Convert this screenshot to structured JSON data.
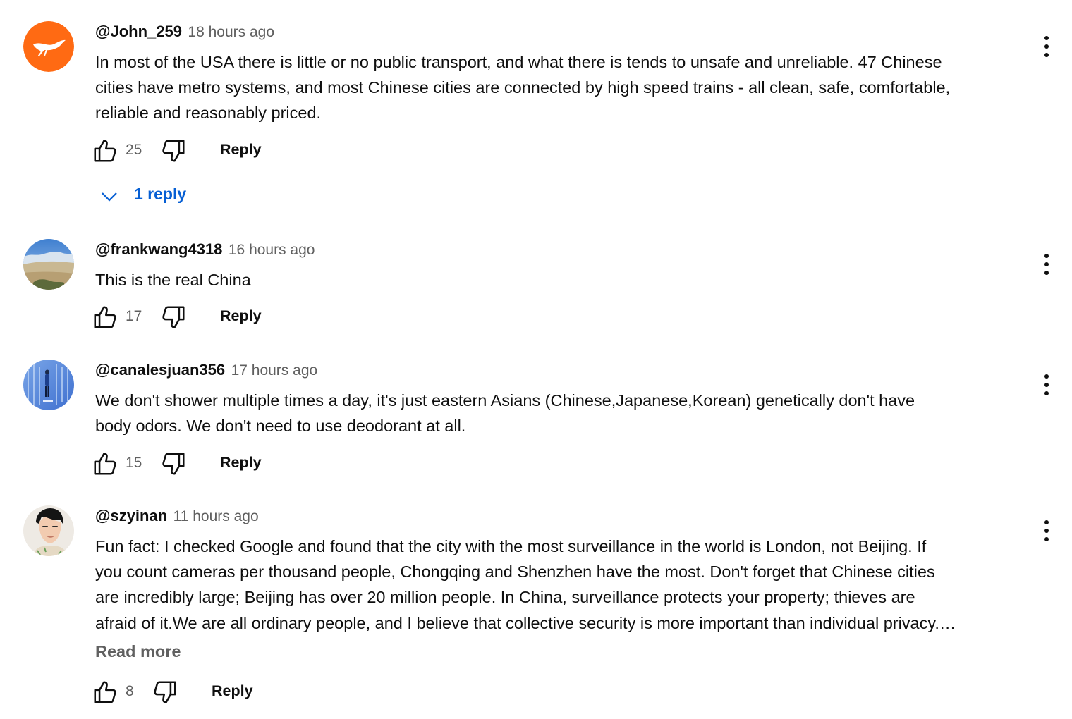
{
  "comments": [
    {
      "author": "@John_259",
      "time": "18 hours ago",
      "lines": [
        "In most of the USA there is little or no public transport, and what there is tends to unsafe and unreliable. 47 Chinese",
        "cities have metro systems, and most Chinese cities are connected by high speed trains - all clean, safe, comfortable,",
        "reliable and reasonably priced."
      ],
      "likes": "25",
      "reply_label": "Reply",
      "replies_label": "1 reply",
      "avatar_icon": "bird-logo-icon",
      "avatar_color": "#ff6a13"
    },
    {
      "author": "@frankwang4318",
      "time": "16 hours ago",
      "lines": [
        "This is the real China"
      ],
      "likes": "17",
      "reply_label": "Reply",
      "avatar_icon": "landscape-photo-icon"
    },
    {
      "author": "@canalesjuan356",
      "time": "17 hours ago",
      "lines": [
        "We don't shower multiple times a day, it's just eastern Asians (Chinese,Japanese,Korean)  genetically don't have",
        "body odors. We don't need to use deodorant at all."
      ],
      "likes": "15",
      "reply_label": "Reply",
      "avatar_icon": "blue-photo-icon"
    },
    {
      "author": "@szyinan",
      "time": "11 hours ago",
      "lines": [
        "Fun fact: I checked Google and found that the city with the most surveillance in the world is London, not Beijing. If",
        "you count cameras per thousand people, Chongqing and Shenzhen have the most. Don't forget that Chinese cities",
        "are incredibly large; Beijing has over 20 million people. In China, surveillance protects your property; thieves are",
        "afraid of it.We are all ordinary people, and I believe that collective security is more important than individual privacy.…"
      ],
      "read_more": "Read more",
      "likes": "8",
      "reply_label": "Reply",
      "avatar_icon": "portrait-drawing-icon"
    }
  ],
  "colors": {
    "primary_text": "#0f0f0f",
    "secondary_text": "#606060",
    "link_blue": "#065fd4"
  }
}
